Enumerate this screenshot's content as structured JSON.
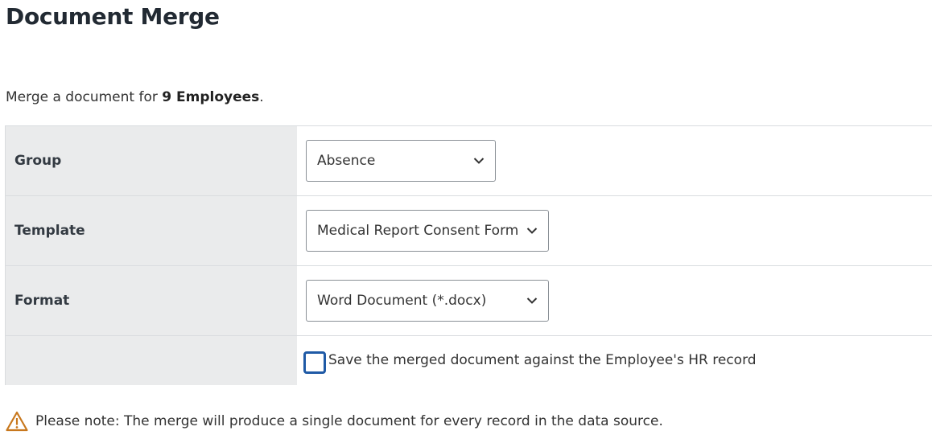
{
  "page": {
    "title": "Document Merge",
    "intro_prefix": "Merge a document for ",
    "intro_count": "9 Employees",
    "intro_suffix": "."
  },
  "form": {
    "group": {
      "label": "Group",
      "value": "Absence"
    },
    "template": {
      "label": "Template",
      "value": "Medical Report Consent Form"
    },
    "format": {
      "label": "Format",
      "value": "Word Document (*.docx)"
    },
    "save_against_record": {
      "label": "Save the merged document against the Employee's HR record",
      "checked": false
    }
  },
  "note": {
    "icon": "warning-icon",
    "text": "Please note: The merge will produce a single document for every record in the data source."
  },
  "colors": {
    "checkbox_border": "#1f5aa6",
    "warning": "#c8781e",
    "label_background": "#eaebec"
  }
}
